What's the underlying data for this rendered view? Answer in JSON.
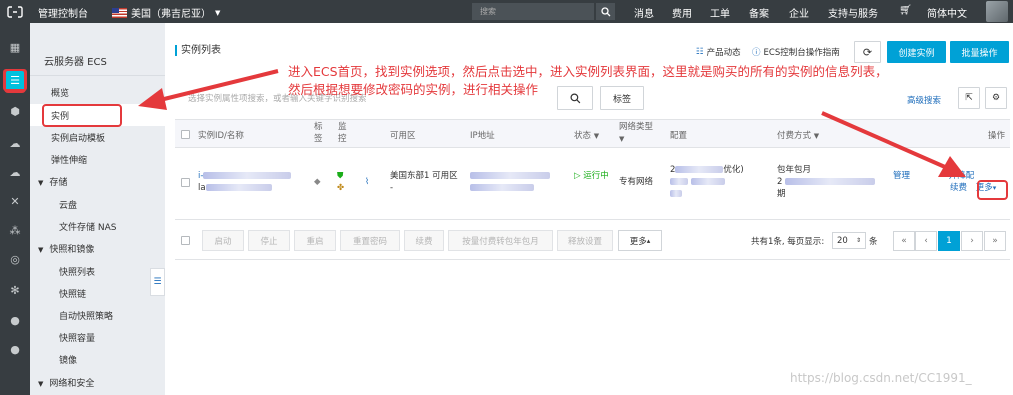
{
  "topbar": {
    "console_title": "管理控制台",
    "region": "美国（弗吉尼亚）",
    "search_placeholder": "搜索",
    "nav": [
      "消息",
      "费用",
      "工单",
      "备案",
      "企业",
      "支持与服务",
      "简体中文"
    ]
  },
  "sidebar": {
    "title": "云服务器 ECS",
    "items": [
      {
        "label": "概览"
      },
      {
        "label": "实例"
      },
      {
        "label": "实例启动模板"
      },
      {
        "label": "弹性伸缩"
      },
      {
        "label": "存储"
      },
      {
        "label": "云盘"
      },
      {
        "label": "文件存储 NAS"
      },
      {
        "label": "快照和镜像"
      },
      {
        "label": "快照列表"
      },
      {
        "label": "快照链"
      },
      {
        "label": "自动快照策略"
      },
      {
        "label": "快照容量"
      },
      {
        "label": "镜像"
      },
      {
        "label": "网络和安全"
      }
    ]
  },
  "main": {
    "page_title": "实例列表",
    "header_links": {
      "product_news": "产品动态",
      "ecs_guide": "ECS控制台操作指南"
    },
    "buttons": {
      "create": "创建实例",
      "batch": "批量操作",
      "tag": "标签",
      "advanced_search": "高级搜索"
    },
    "filter_placeholder": "选择实例属性项搜索，或者输入关键字识别搜索",
    "columns": [
      "实例ID/名称",
      "标签",
      "监控",
      "可用区",
      "IP地址",
      "状态",
      "网络类型",
      "配置",
      "付费方式",
      "操作"
    ],
    "row": {
      "zone": "美国东部1 可用区",
      "zone_suffix": "-",
      "status": "运行中",
      "network": "专有网络",
      "config_suffix": "优化)",
      "billing": "包年包月",
      "billing_suffix": "期",
      "actions": {
        "manage": "管理",
        "renew": "续费",
        "upgrade": "升降配",
        "more": "更多"
      }
    },
    "footer_buttons": [
      "启动",
      "停止",
      "重启",
      "重置密码",
      "续费",
      "按量付费转包年包月",
      "释放设置"
    ],
    "footer_more": "更多",
    "pagination": {
      "summary_prefix": "共有1条, 每页显示:",
      "page_size": "20",
      "summary_suffix": "条",
      "current": "1",
      "controls": [
        "«",
        "‹",
        "›",
        "»"
      ]
    }
  },
  "annotation": {
    "line1": "进入ECS首页，找到实例选项，然后点击选中，进入实例列表界面，这里就是购买的所有的实例的信息列表，",
    "line2": "然后根据想要修改密码的实例，进行相关操作"
  },
  "watermark": "https://blog.csdn.net/CC1991_",
  "colors": {
    "accent": "#00a1d6",
    "topbar": "#373d41",
    "annotation": "#e4393c",
    "running": "#1aad19"
  }
}
